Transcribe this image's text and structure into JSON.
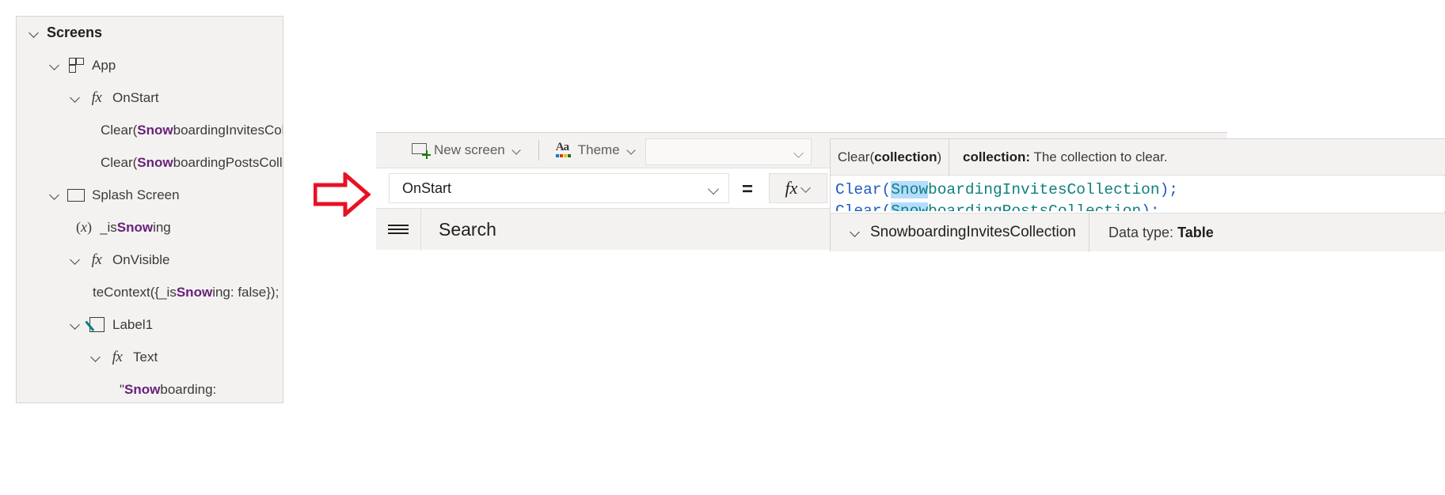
{
  "tree": {
    "root_label": "Screens",
    "items": [
      {
        "label": "App",
        "icon": "app-grid-icon",
        "indent": "row-app",
        "chevron": true
      },
      {
        "label": "OnStart",
        "icon": "fx-icon",
        "indent": "row-onstart",
        "chevron": true
      },
      {
        "label_html": "Clear(<b>Snow</b>boardingInvitesColle...",
        "icon": "none",
        "indent": "row-code1",
        "chevron": false
      },
      {
        "label_html": "Clear(<b>Snow</b>boardingPostsCollec...",
        "icon": "none",
        "indent": "row-code2",
        "chevron": false
      },
      {
        "label": "Splash Screen",
        "icon": "screen-icon",
        "indent": "row-splash",
        "chevron": true
      },
      {
        "label_html": "_is<b>Snow</b>ing",
        "icon": "variable-icon",
        "indent": "row-issnowing",
        "chevron": false
      },
      {
        "label": "OnVisible",
        "icon": "fx-icon",
        "indent": "row-onvisible",
        "chevron": true
      },
      {
        "label_html": "teContext({_is<b>Snow</b>ing: false});",
        "icon": "none",
        "indent": "row-code3",
        "chevron": false
      },
      {
        "label": "Label1",
        "icon": "label-icon",
        "indent": "row-label1",
        "chevron": true
      },
      {
        "label": "Text",
        "icon": "fx-icon",
        "indent": "row-text",
        "chevron": true
      },
      {
        "label_html": "\"<b>Snow</b>boarding:",
        "icon": "none",
        "indent": "row-code4",
        "chevron": false
      }
    ]
  },
  "annotation": {
    "arrow_color": "#e81123",
    "arrow_direction": "right"
  },
  "editor": {
    "toolbar": {
      "new_screen_label": "New screen",
      "theme_label": "Theme",
      "combo_value": ""
    },
    "formula_bar": {
      "property_value": "OnStart",
      "equals": "=",
      "fx_glyph": "fx"
    },
    "search_bar": {
      "label": "Search",
      "hamburger": "hamburger-icon",
      "clear": "close-icon"
    }
  },
  "intellisense": {
    "signature_prefix": "Clear(",
    "signature_param": "collection",
    "signature_suffix": ")",
    "description_param": "collection:",
    "description_text": "The collection to clear.",
    "code": {
      "line1": {
        "fn": "Clear",
        "open": "(",
        "selected": "Snow",
        "rest": "boardingInvitesCollection",
        "close": ");"
      },
      "line2": {
        "fn": "Clear",
        "open": "(",
        "selected": "Snow",
        "rest": "boardingPostsCollection",
        "close": ");"
      }
    },
    "suggestion": {
      "name": "SnowboardingInvitesCollection",
      "type_label": "Data type:",
      "type_value": "Table"
    },
    "colors": {
      "function_blue": "#1f5bbf",
      "identifier_teal": "#0f7f7f",
      "selection_highlight": "#b5dcff",
      "highlight_purple": "#68217a"
    }
  }
}
